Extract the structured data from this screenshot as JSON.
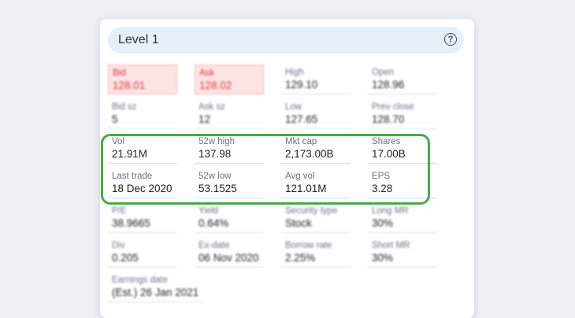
{
  "panel": {
    "title": "Level 1",
    "help_glyph": "?",
    "help_icon": "question-circle-icon"
  },
  "rows": [
    [
      {
        "label": "Bid",
        "value": "128.01"
      },
      {
        "label": "Ask",
        "value": "128.02"
      },
      {
        "label": "High",
        "value": "129.10"
      },
      {
        "label": "Open",
        "value": "128.96"
      }
    ],
    [
      {
        "label": "Bid sz",
        "value": "5"
      },
      {
        "label": "Ask sz",
        "value": "12"
      },
      {
        "label": "Low",
        "value": "127.65"
      },
      {
        "label": "Prev close",
        "value": "128.70"
      }
    ],
    [
      {
        "label": "Vol",
        "value": "21.91M"
      },
      {
        "label": "52w high",
        "value": "137.98"
      },
      {
        "label": "Mkt cap",
        "value": "2,173.00B"
      },
      {
        "label": "Shares",
        "value": "17.00B"
      }
    ],
    [
      {
        "label": "Last trade",
        "value": "18 Dec 2020"
      },
      {
        "label": "52w low",
        "value": "53.1525"
      },
      {
        "label": "Avg vol",
        "value": "121.01M"
      },
      {
        "label": "EPS",
        "value": "3.28"
      }
    ],
    [
      {
        "label": "P/E",
        "value": "38.9665"
      },
      {
        "label": "Yield",
        "value": "0.64%"
      },
      {
        "label": "Security type",
        "value": "Stock"
      },
      {
        "label": "Long MR",
        "value": "30%"
      }
    ],
    [
      {
        "label": "Div",
        "value": "0.205"
      },
      {
        "label": "Ex-date",
        "value": "06 Nov 2020"
      },
      {
        "label": "Borrow rate",
        "value": "2.25%"
      },
      {
        "label": "Short MR",
        "value": "30%"
      }
    ],
    [
      {
        "label": "Earnings date",
        "value": "(Est.) 26 Jan 2021"
      }
    ]
  ],
  "colors": {
    "highlight_outline": "#49a84b",
    "bid_ask_text": "#d9333f",
    "bid_ask_bg": "#fde4e4"
  }
}
